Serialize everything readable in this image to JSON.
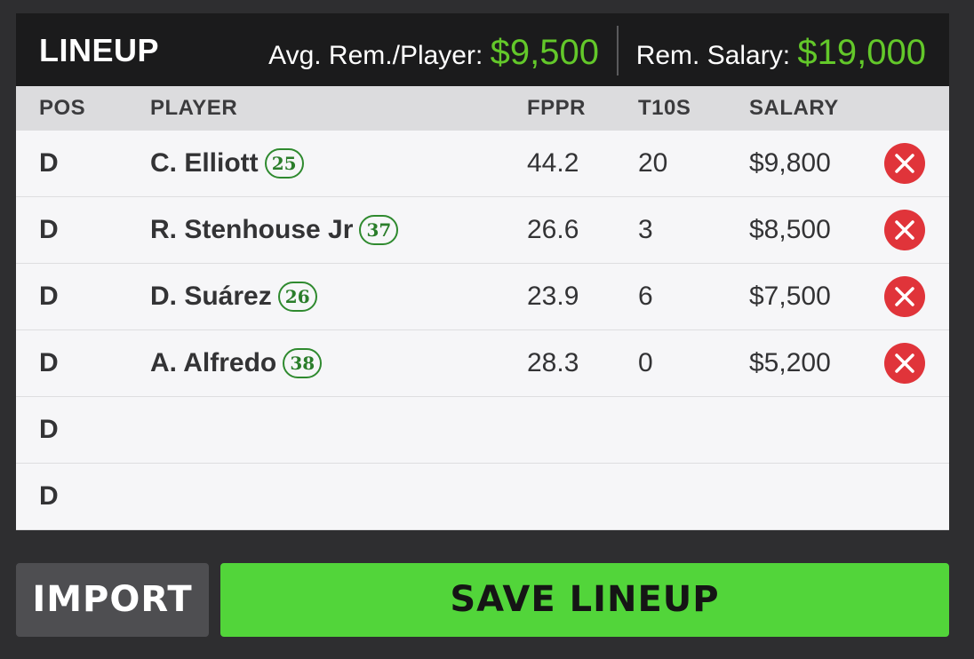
{
  "header": {
    "title": "LINEUP",
    "avg_label": "Avg. Rem./Player: ",
    "avg_value": "$9,500",
    "rem_label": "Rem. Salary: ",
    "rem_value": "$19,000",
    "accent_color": "#63c82a"
  },
  "columns": {
    "pos": "POS",
    "player": "PLAYER",
    "fppr": "FPPR",
    "t10s": "T10S",
    "salary": "SALARY"
  },
  "rows": [
    {
      "pos": "D",
      "player": "C. Elliott",
      "car": "25",
      "fppr": "44.2",
      "t10s": "20",
      "salary": "$9,800",
      "remove_icon": "remove-x-icon"
    },
    {
      "pos": "D",
      "player": "R. Stenhouse Jr",
      "car": "37",
      "fppr": "26.6",
      "t10s": "3",
      "salary": "$8,500",
      "remove_icon": "remove-x-icon"
    },
    {
      "pos": "D",
      "player": "D. Suárez",
      "car": "26",
      "fppr": "23.9",
      "t10s": "6",
      "salary": "$7,500",
      "remove_icon": "remove-x-icon"
    },
    {
      "pos": "D",
      "player": "A. Alfredo",
      "car": "38",
      "fppr": "28.3",
      "t10s": "0",
      "salary": "$5,200",
      "remove_icon": "remove-x-icon"
    },
    {
      "pos": "D"
    },
    {
      "pos": "D"
    }
  ],
  "buttons": {
    "import": "IMPORT",
    "save": "SAVE LINEUP"
  },
  "colors": {
    "save_button": "#52d53a",
    "remove_button": "#e0343a",
    "car_badge": "#2a7d2a"
  }
}
